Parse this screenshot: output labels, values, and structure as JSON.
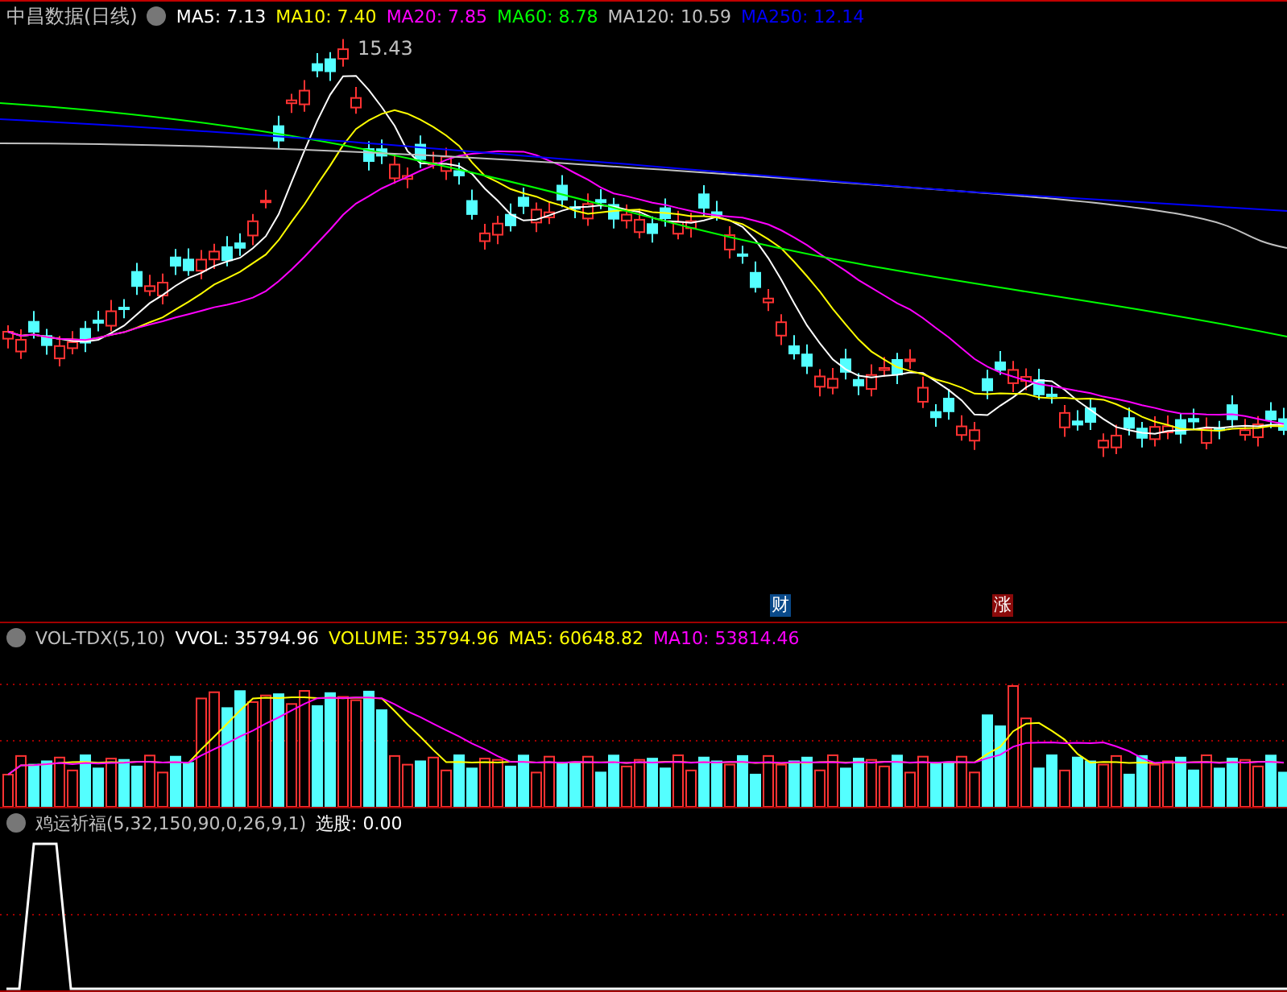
{
  "main_panel": {
    "title": "中昌数据(日线)",
    "legend": [
      {
        "label": "MA5: 7.13",
        "color": "#ffffff"
      },
      {
        "label": "MA10: 7.40",
        "color": "#ffff00"
      },
      {
        "label": "MA20: 7.85",
        "color": "#ff00ff"
      },
      {
        "label": "MA60: 8.78",
        "color": "#00ff00"
      },
      {
        "label": "MA120: 10.59",
        "color": "#c0c0c0"
      },
      {
        "label": "MA250: 12.14",
        "color": "#0000ff"
      }
    ],
    "high_label": "15.43",
    "markers": [
      {
        "text": "财",
        "color": "#0a4a8a"
      },
      {
        "text": "涨",
        "color": "#8a0a0a"
      }
    ]
  },
  "volume_panel": {
    "legend": [
      {
        "label": "VOL-TDX(5,10)",
        "color": "#c0c0c0"
      },
      {
        "label": "VVOL: 35794.96",
        "color": "#ffffff"
      },
      {
        "label": "VOLUME: 35794.96",
        "color": "#ffff00"
      },
      {
        "label": "MA5: 60648.82",
        "color": "#ffff00"
      },
      {
        "label": "MA10: 53814.46",
        "color": "#ff00ff"
      }
    ]
  },
  "indicator_panel": {
    "legend": [
      {
        "label": "鸡运祈福(5,32,150,90,0,26,9,1)",
        "color": "#c0c0c0"
      },
      {
        "label": "选股: 0.00",
        "color": "#ffffff"
      }
    ]
  }
}
